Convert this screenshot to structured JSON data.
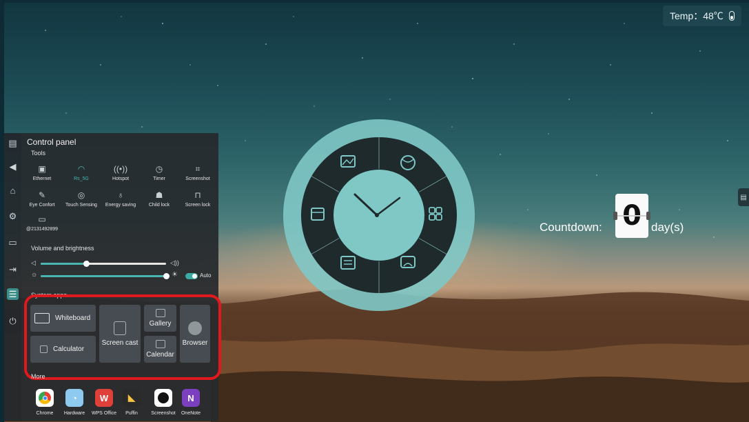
{
  "status": {
    "temp_label": "Temp：48℃"
  },
  "sidebar_icons": [
    "panel-icon",
    "back-icon",
    "home-icon",
    "settings-icon",
    "folder-icon",
    "input-source-icon",
    "control-panel-icon",
    "power-icon"
  ],
  "control_panel": {
    "title": "Control panel",
    "tools_label": "Tools",
    "tools": [
      {
        "label": "Ethernet",
        "icon": "ethernet-icon"
      },
      {
        "label": "Rs_5G",
        "icon": "wifi-icon",
        "active": true
      },
      {
        "label": "Hotspot",
        "icon": "hotspot-icon"
      },
      {
        "label": "Timer",
        "icon": "timer-icon"
      },
      {
        "label": "Screenshot",
        "icon": "screenshot-icon"
      },
      {
        "label": "Eye Confort",
        "icon": "eye-comfort-icon"
      },
      {
        "label": "Touch Sensing",
        "icon": "touch-sensing-icon"
      },
      {
        "label": "Energy saving",
        "icon": "energy-saving-icon"
      },
      {
        "label": "Child lock",
        "icon": "child-lock-icon"
      },
      {
        "label": "Screen lock",
        "icon": "screen-lock-icon"
      },
      {
        "label": "@2131492899",
        "icon": "input-icon"
      }
    ],
    "volume_brightness_label": "Volume and brightness",
    "volume": 0.36,
    "brightness": 1.0,
    "auto_label": "Auto",
    "auto_enabled": true,
    "system_apps_label": "System apps",
    "system_apps": {
      "whiteboard": "Whiteboard",
      "screen_cast": "Screen cast",
      "gallery": "Gallery",
      "browser": "Browser",
      "calculator": "Calculator",
      "calendar": "Calendar"
    },
    "more_label": "More",
    "more_apps": [
      {
        "label": "Chrome",
        "icon": "chrome-icon",
        "color": "#ffffff"
      },
      {
        "label": "Hardware",
        "icon": "hardware-icon",
        "color": "#8ec9f0"
      },
      {
        "label": "WPS Office",
        "icon": "wps-icon",
        "color": "#e0403a"
      },
      {
        "label": "Puffin",
        "icon": "puffin-icon",
        "color": "#2a2a2a"
      },
      {
        "label": "Screenshot",
        "icon": "screenshot-app-icon",
        "color": "#ffffff"
      },
      {
        "label": "OneNote",
        "icon": "onenote-icon",
        "color": "#7b3fbf"
      }
    ]
  },
  "widgets": {
    "countdown_label": "Countdown:",
    "countdown_value": "0",
    "countdown_unit": "day(s)",
    "clock_time": "10:08",
    "clock_segments": [
      "gallery-icon",
      "browser-icon",
      "apps-icon",
      "screen-cast-icon",
      "calculator-icon",
      "calendar-icon"
    ]
  },
  "colors": {
    "accent": "#4ab6b0",
    "highlight_box": "#e0191f",
    "clock_ring": "#7fc8c6",
    "clock_inner": "#1f2a2c"
  }
}
